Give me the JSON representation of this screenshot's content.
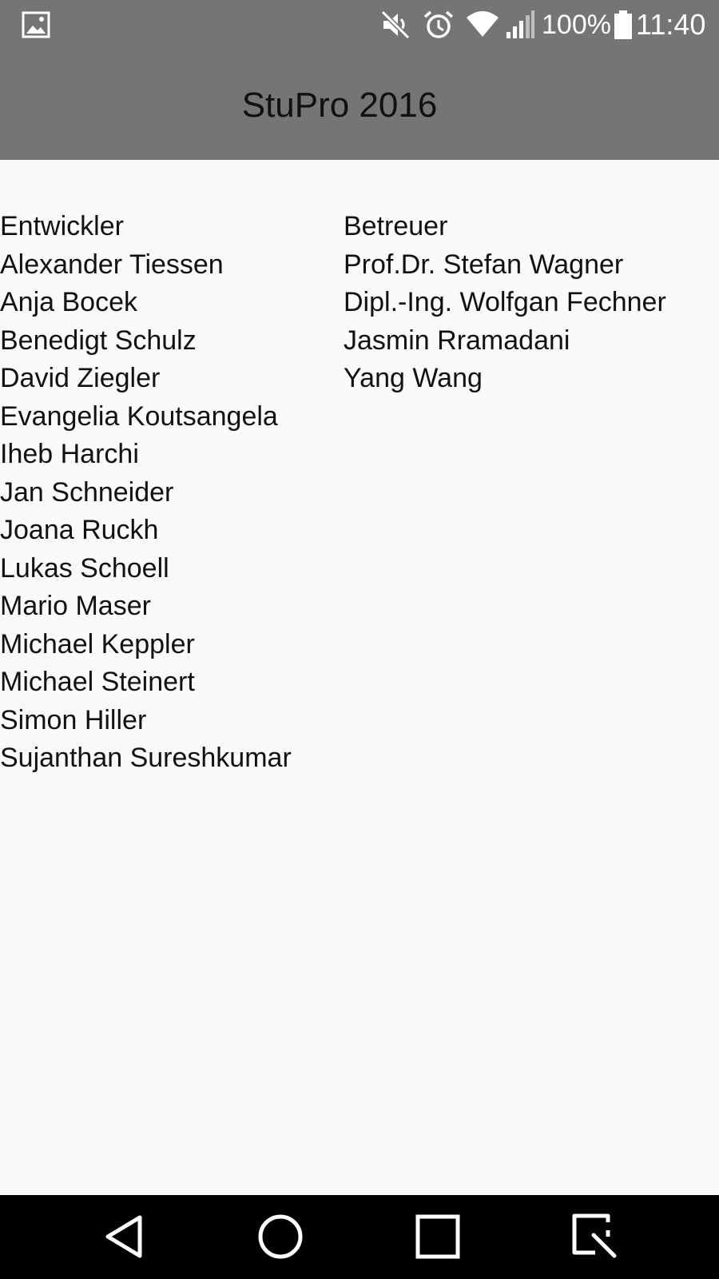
{
  "status_bar": {
    "battery_percent": "100%",
    "time": "11:40",
    "icons": [
      "gallery-icon",
      "mute-icon",
      "alarm-icon",
      "wifi-icon",
      "signal-icon",
      "battery-icon"
    ]
  },
  "app": {
    "title": "StuPro 2016"
  },
  "developers": {
    "heading": "Entwickler",
    "names": [
      "Alexander Tiessen",
      "Anja Bocek",
      "Benedigt Schulz",
      "David Ziegler",
      "Evangelia Koutsangela",
      "Iheb Harchi",
      "Jan Schneider",
      "Joana Ruckh",
      "Lukas Schoell",
      "Mario Maser",
      "Michael Keppler",
      "Michael Steinert",
      "Simon Hiller",
      "Sujanthan Sureshkumar"
    ]
  },
  "supervisors": {
    "heading": "Betreuer",
    "names": [
      "Prof.Dr. Stefan Wagner",
      "Dipl.-Ing. Wolfgan Fechner",
      "Jasmin Rramadani",
      "Yang Wang"
    ]
  },
  "nav_bar": {
    "icons": [
      "back-icon",
      "home-icon",
      "recents-icon",
      "screen-capture-icon"
    ]
  },
  "colors": {
    "header_bg": "#757575",
    "content_bg": "#fafafa",
    "nav_bg": "#000000",
    "text": "#111111"
  }
}
